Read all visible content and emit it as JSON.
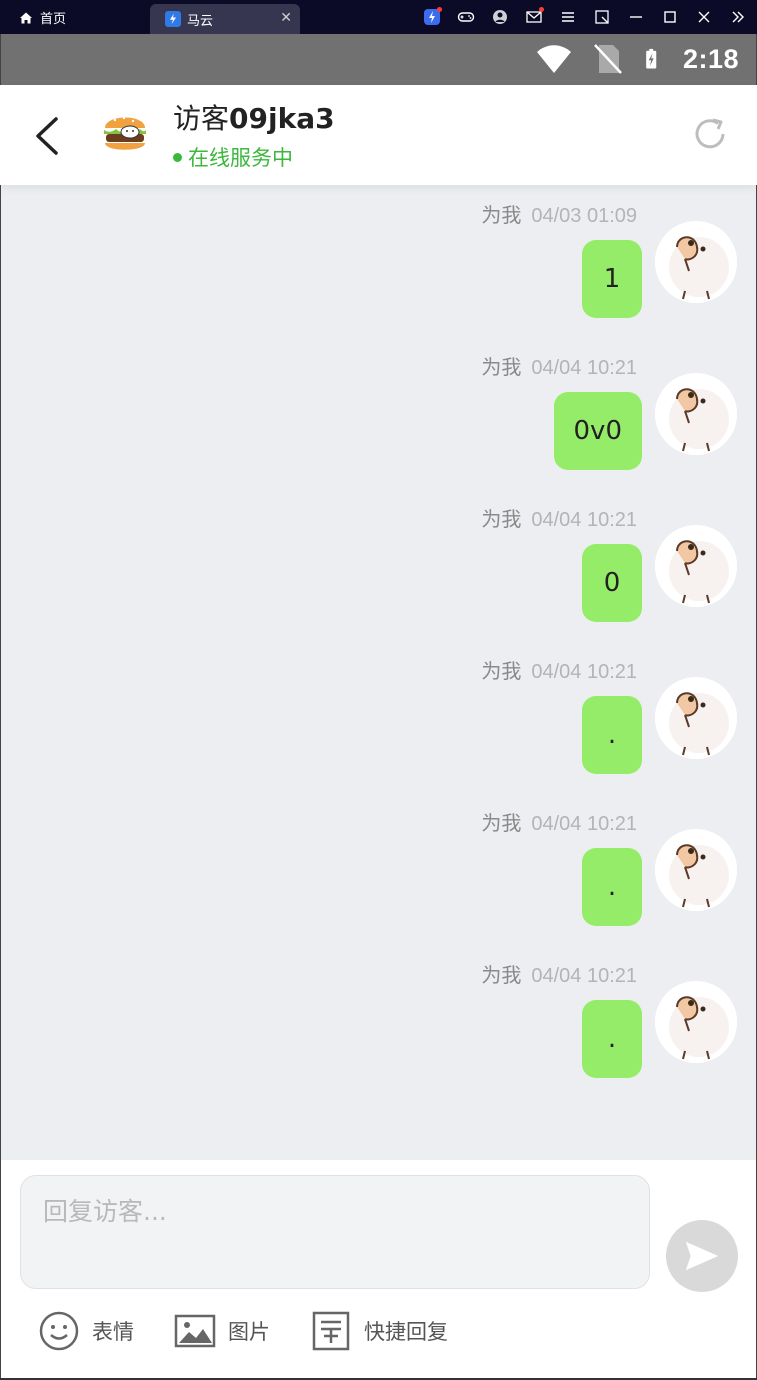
{
  "window": {
    "home_tab_label": "首页",
    "app_tab_label": "马云",
    "close_glyph": "✕"
  },
  "status_bar": {
    "time": "2:18"
  },
  "header": {
    "title_prefix": "访客",
    "title_id": "09jka3",
    "status": "在线服务中"
  },
  "messages": [
    {
      "sender": "为我",
      "time": "04/03 01:09",
      "text": "1"
    },
    {
      "sender": "为我",
      "time": "04/04 10:21",
      "text": "0v0"
    },
    {
      "sender": "为我",
      "time": "04/04 10:21",
      "text": "0"
    },
    {
      "sender": "为我",
      "time": "04/04 10:21",
      "text": "."
    },
    {
      "sender": "为我",
      "time": "04/04 10:21",
      "text": "."
    },
    {
      "sender": "为我",
      "time": "04/04 10:21",
      "text": "."
    }
  ],
  "composer": {
    "placeholder": "回复访客...",
    "tools": {
      "emoji_label": "表情",
      "image_label": "图片",
      "quick_reply_label": "快捷回复"
    }
  },
  "colors": {
    "bubble": "#95ec69",
    "online": "#3cb83c",
    "chat_bg": "#eceef1"
  }
}
